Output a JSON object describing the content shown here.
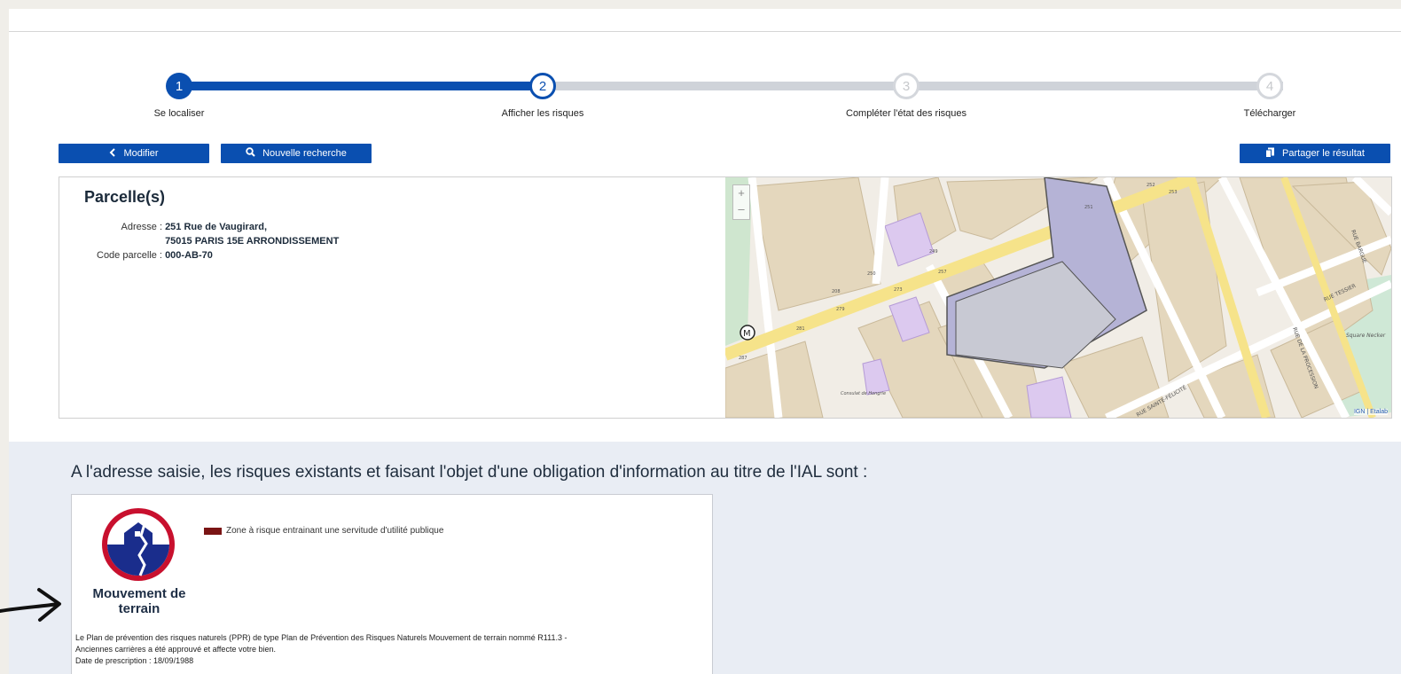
{
  "stepper": {
    "steps": [
      {
        "number": "1",
        "label": "Se localiser",
        "state": "done"
      },
      {
        "number": "2",
        "label": "Afficher les risques",
        "state": "current"
      },
      {
        "number": "3",
        "label": "Compléter l'état des risques",
        "state": "future"
      },
      {
        "number": "4",
        "label": "Télécharger",
        "state": "future"
      }
    ]
  },
  "toolbar": {
    "modify_label": "Modifier",
    "new_search_label": "Nouvelle recherche",
    "share_label": "Partager le résultat"
  },
  "parcel": {
    "title": "Parcelle(s)",
    "address_label": "Adresse :",
    "address_line1": "251 Rue de Vaugirard,",
    "address_line2": "75015 PARIS 15E ARRONDISSEMENT",
    "code_label": "Code parcelle :",
    "code_value": "000-AB-70"
  },
  "map": {
    "zoom_in": "+",
    "zoom_out": "–",
    "attribution": "IGN | Etalab",
    "street_labels": [
      "RUE BARGUE",
      "RUE TESSIER",
      "Square Necker",
      "RUE DE LA PROCESSION",
      "RUE SAINTE-FÉLICITÉ",
      "Consulat de Hongrie"
    ],
    "numbers": [
      "251",
      "273",
      "279",
      "249",
      "257",
      "208",
      "250",
      "252",
      "253",
      "281",
      "287"
    ]
  },
  "risks": {
    "heading": "A l'adresse saisie, les risques existants et faisant l'objet d'une obligation d'information au titre de l'IAL sont :",
    "card": {
      "name_line1": "Mouvement de",
      "name_line2": "terrain",
      "legend": "Zone à risque entrainant une servitude d'utilité publique",
      "description_line1": "Le Plan de prévention des risques naturels (PPR) de type Plan de Prévention des Risques Naturels Mouvement de terrain nommé R111.3 -",
      "description_line2": "Anciennes carrières a été approuvé et affecte votre bien.",
      "prescription": "Date de prescription : 18/09/1988"
    }
  },
  "colors": {
    "primary": "#0a4fb0",
    "inactive_track": "#cfd3d9",
    "risk_swatch": "#7a1414",
    "lower_bg": "#e9edf4"
  }
}
